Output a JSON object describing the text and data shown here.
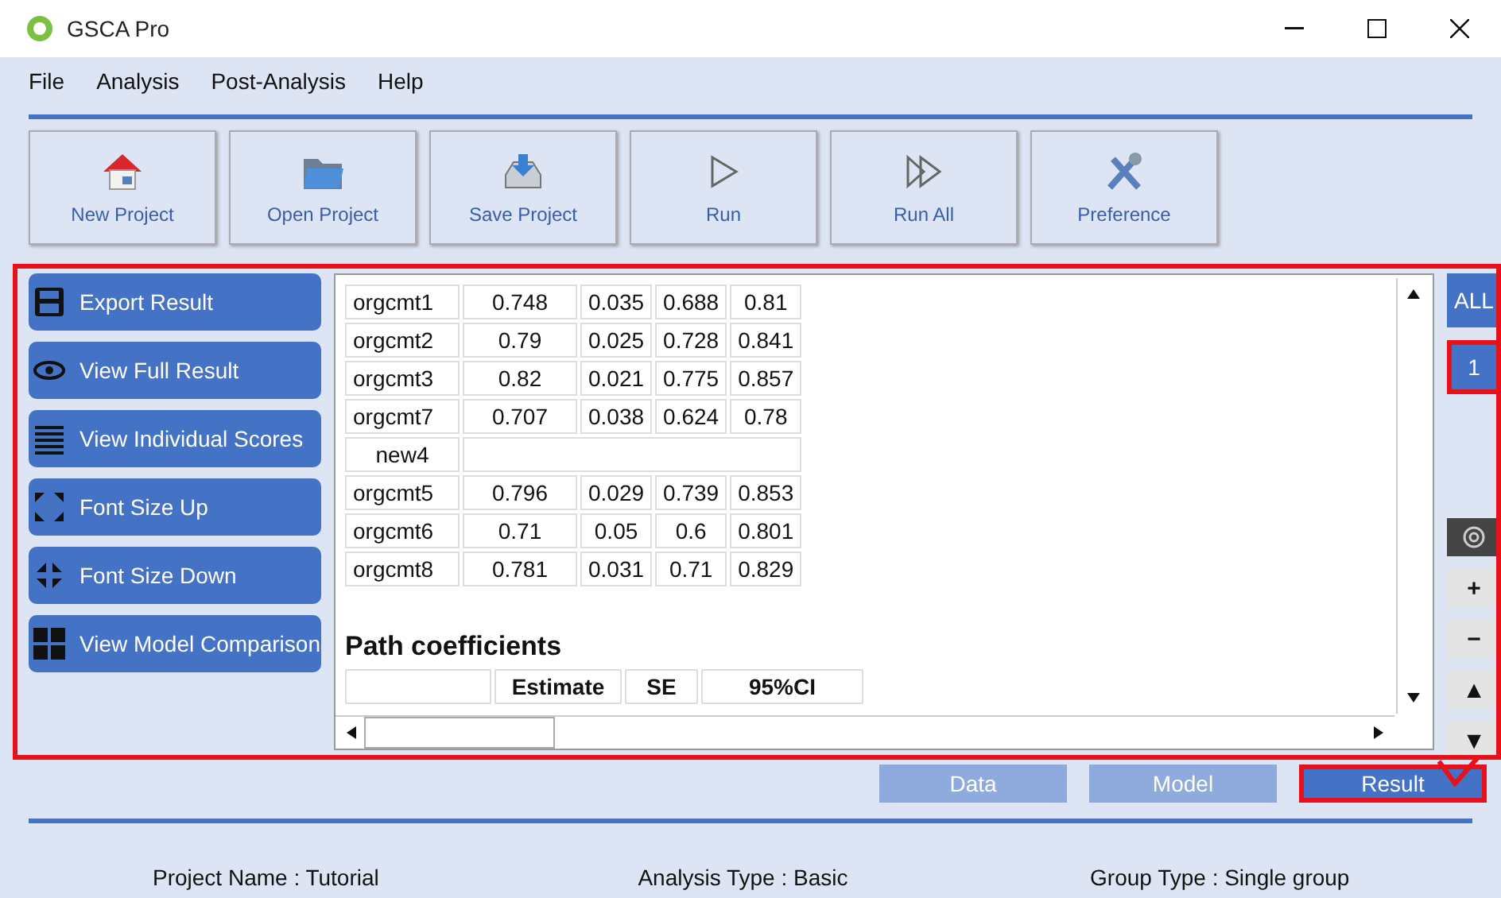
{
  "window": {
    "title": "GSCA Pro"
  },
  "menu": [
    "File",
    "Analysis",
    "Post-Analysis",
    "Help"
  ],
  "toolbar": [
    {
      "kind": "home",
      "label": "New Project"
    },
    {
      "kind": "folder",
      "label": "Open Project"
    },
    {
      "kind": "save",
      "label": "Save Project"
    },
    {
      "kind": "run",
      "label": "Run"
    },
    {
      "kind": "runall",
      "label": "Run All"
    },
    {
      "kind": "tools",
      "label": "Preference"
    }
  ],
  "side_actions": [
    {
      "kind": "save",
      "label": "Export Result"
    },
    {
      "kind": "eye",
      "label": "View Full Result"
    },
    {
      "kind": "list",
      "label": "View Individual Scores"
    },
    {
      "kind": "expand",
      "label": "Font Size Up"
    },
    {
      "kind": "shrink",
      "label": "Font Size Down"
    },
    {
      "kind": "grid",
      "label": "View Model Comparison"
    }
  ],
  "loadings": [
    {
      "kind": "row",
      "cells": [
        "orgcmt1",
        "0.748",
        "0.035",
        "0.688",
        "0.81"
      ]
    },
    {
      "kind": "row",
      "cells": [
        "orgcmt2",
        "0.79",
        "0.025",
        "0.728",
        "0.841"
      ]
    },
    {
      "kind": "row",
      "cells": [
        "orgcmt3",
        "0.82",
        "0.021",
        "0.775",
        "0.857"
      ]
    },
    {
      "kind": "row",
      "cells": [
        "orgcmt7",
        "0.707",
        "0.038",
        "0.624",
        "0.78"
      ]
    },
    {
      "kind": "group",
      "cells": [
        "new4"
      ]
    },
    {
      "kind": "row",
      "cells": [
        "orgcmt5",
        "0.796",
        "0.029",
        "0.739",
        "0.853"
      ]
    },
    {
      "kind": "row",
      "cells": [
        "orgcmt6",
        "0.71",
        "0.05",
        "0.6",
        "0.801"
      ]
    },
    {
      "kind": "row",
      "cells": [
        "orgcmt8",
        "0.781",
        "0.031",
        "0.71",
        "0.829"
      ]
    }
  ],
  "path_coefficients": {
    "title": "Path coefficients",
    "columns": [
      "",
      "Estimate",
      "SE",
      "95%CI"
    ]
  },
  "group_buttons": [
    {
      "label": "ALL",
      "selected": false
    },
    {
      "label": "1",
      "selected": true
    }
  ],
  "view_controls": [
    {
      "kind": "target"
    },
    {
      "label": "+",
      "kind": "text"
    },
    {
      "label": "−",
      "kind": "text"
    },
    {
      "label": "▲",
      "kind": "text"
    },
    {
      "label": "▼",
      "kind": "text"
    }
  ],
  "tabs": [
    {
      "label": "Data",
      "selected": false
    },
    {
      "label": "Model",
      "selected": false
    },
    {
      "label": "Result",
      "selected": true
    }
  ],
  "status_bar": [
    "Project Name : Tutorial",
    "Analysis Type : Basic",
    "Group Type : Single group"
  ]
}
